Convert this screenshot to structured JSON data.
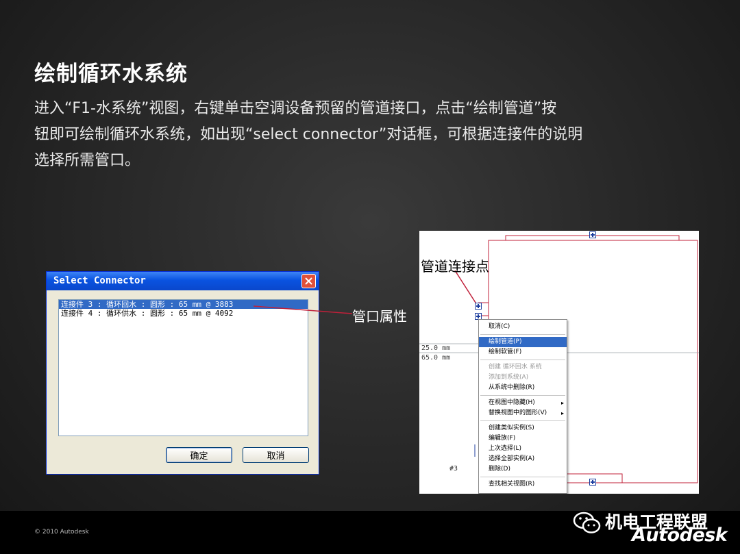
{
  "slide": {
    "title": "绘制循环水系统",
    "body_lines": [
      "进入“F1-水系统”视图，右键单击空调设备预留的管道接口，点击“绘制管道”按",
      "钮即可绘制循环水系统，如出现“select connector”对话框，可根据连接件的说明",
      "选择所需管口。"
    ]
  },
  "dialog": {
    "title": "Select Connector",
    "items": [
      "连接件 3 : 循环回水 : 圆形 : 65 mm @ 3883",
      "连接件 4 : 循环供水 : 圆形 : 65 mm @ 4092"
    ],
    "selected_index": 0,
    "ok_label": "确定",
    "cancel_label": "取消"
  },
  "annotations": {
    "port_attr": "管口属性",
    "connection_point": "管道连接点"
  },
  "drawing": {
    "dim_top": "25.0 mm",
    "dim_bottom": "65.0 mm",
    "tag": "#3",
    "context_menu": [
      {
        "label": "取消(C)",
        "state": "normal"
      },
      {
        "sep": true
      },
      {
        "label": "绘制管道(P)",
        "state": "selected"
      },
      {
        "label": "绘制软管(F)",
        "state": "normal"
      },
      {
        "sep": true
      },
      {
        "label": "创建 循环回水 系统",
        "state": "disabled"
      },
      {
        "label": "添加到系统(A)",
        "state": "disabled"
      },
      {
        "label": "从系统中删除(R)",
        "state": "normal"
      },
      {
        "sep": true
      },
      {
        "label": "在视图中隐藏(H)",
        "state": "submenu"
      },
      {
        "label": "替换视图中的图形(V)",
        "state": "submenu"
      },
      {
        "sep": true
      },
      {
        "label": "创建类似实例(S)",
        "state": "normal"
      },
      {
        "label": "编辑族(F)",
        "state": "normal"
      },
      {
        "label": "上次选择(L)",
        "state": "normal"
      },
      {
        "label": "选择全部实例(A)",
        "state": "normal"
      },
      {
        "label": "删除(D)",
        "state": "normal"
      },
      {
        "sep": true
      },
      {
        "label": "查找相关视图(R)",
        "state": "normal"
      }
    ]
  },
  "footer": {
    "copyright": "© 2010 Autodesk",
    "wechat": "机电工程联盟",
    "brand": "Autodesk"
  },
  "colors": {
    "xp_titlebar": "#0a53e0",
    "selection": "#316ac5",
    "redline": "#c0203a"
  }
}
